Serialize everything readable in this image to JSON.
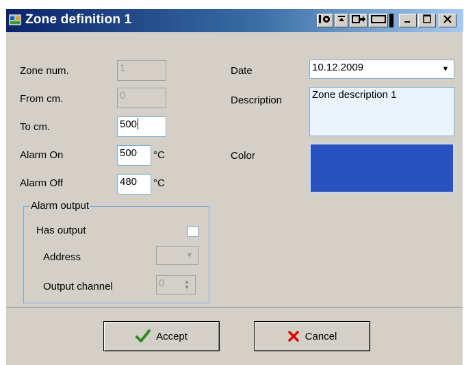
{
  "window": {
    "title": "Zone definition 1"
  },
  "form": {
    "zone_num_label": "Zone num.",
    "zone_num_value": "1",
    "from_cm_label": "From cm.",
    "from_cm_value": "0",
    "to_cm_label": "To cm.",
    "to_cm_value": "500",
    "alarm_on_label": "Alarm On",
    "alarm_on_value": "500",
    "alarm_off_label": "Alarm Off",
    "alarm_off_value": "480",
    "unit": "°C",
    "date_label": "Date",
    "date_value": "10.12.2009",
    "description_label": "Description",
    "description_value": "Zone description 1",
    "color_label": "Color",
    "color_value": "#2a52be"
  },
  "alarm_output": {
    "legend": "Alarm output",
    "has_output_label": "Has output",
    "has_output_checked": false,
    "address_label": "Address",
    "address_value": "",
    "output_channel_label": "Output channel",
    "output_channel_value": "0"
  },
  "buttons": {
    "accept": "Accept",
    "cancel": "Cancel"
  },
  "colors": {
    "title_start": "#0a246a",
    "title_end": "#a6caf0",
    "dialog_bg": "#d4d0c8",
    "field_border": "#7aaed8",
    "accept_icon": "#2e8b1e",
    "cancel_icon": "#e00000"
  },
  "icons": {
    "app": "app-icon",
    "titlebar_extras": [
      "rollup-icon",
      "pin-icon",
      "dock-icon",
      "stretch-icon"
    ],
    "window_controls": [
      "minimize-icon",
      "maximize-icon",
      "close-icon"
    ],
    "accept": "checkmark-icon",
    "cancel": "x-icon",
    "date_dropdown": "chevron-down-icon"
  }
}
